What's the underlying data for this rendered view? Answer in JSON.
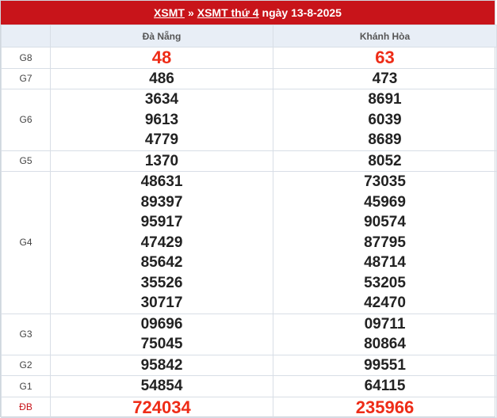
{
  "header": {
    "link1": "XSMT",
    "separator": "»",
    "link2": "XSMT thứ 4",
    "date_text": "ngày 13-8-2025"
  },
  "columns": [
    "Đà Nẵng",
    "Khánh Hòa"
  ],
  "prizes": [
    {
      "label": "G8",
      "values": [
        [
          "48"
        ],
        [
          "63"
        ]
      ]
    },
    {
      "label": "G7",
      "values": [
        [
          "486"
        ],
        [
          "473"
        ]
      ]
    },
    {
      "label": "G6",
      "values": [
        [
          "3634",
          "9613",
          "4779"
        ],
        [
          "8691",
          "6039",
          "8689"
        ]
      ]
    },
    {
      "label": "G5",
      "values": [
        [
          "1370"
        ],
        [
          "8052"
        ]
      ]
    },
    {
      "label": "G4",
      "values": [
        [
          "48631",
          "89397",
          "95917",
          "47429",
          "85642",
          "35526",
          "30717"
        ],
        [
          "73035",
          "45969",
          "90574",
          "87795",
          "48714",
          "53205",
          "42470"
        ]
      ]
    },
    {
      "label": "G3",
      "values": [
        [
          "09696",
          "75045"
        ],
        [
          "09711",
          "80864"
        ]
      ]
    },
    {
      "label": "G2",
      "values": [
        [
          "95842"
        ],
        [
          "99551"
        ]
      ]
    },
    {
      "label": "G1",
      "values": [
        [
          "54854"
        ],
        [
          "64115"
        ]
      ]
    },
    {
      "label": "ĐB",
      "values": [
        [
          "724034"
        ],
        [
          "235966"
        ]
      ]
    }
  ],
  "colors": {
    "header_bg": "#c8141a",
    "highlight": "#ee2c17",
    "table_header_bg": "#e8eef6"
  }
}
